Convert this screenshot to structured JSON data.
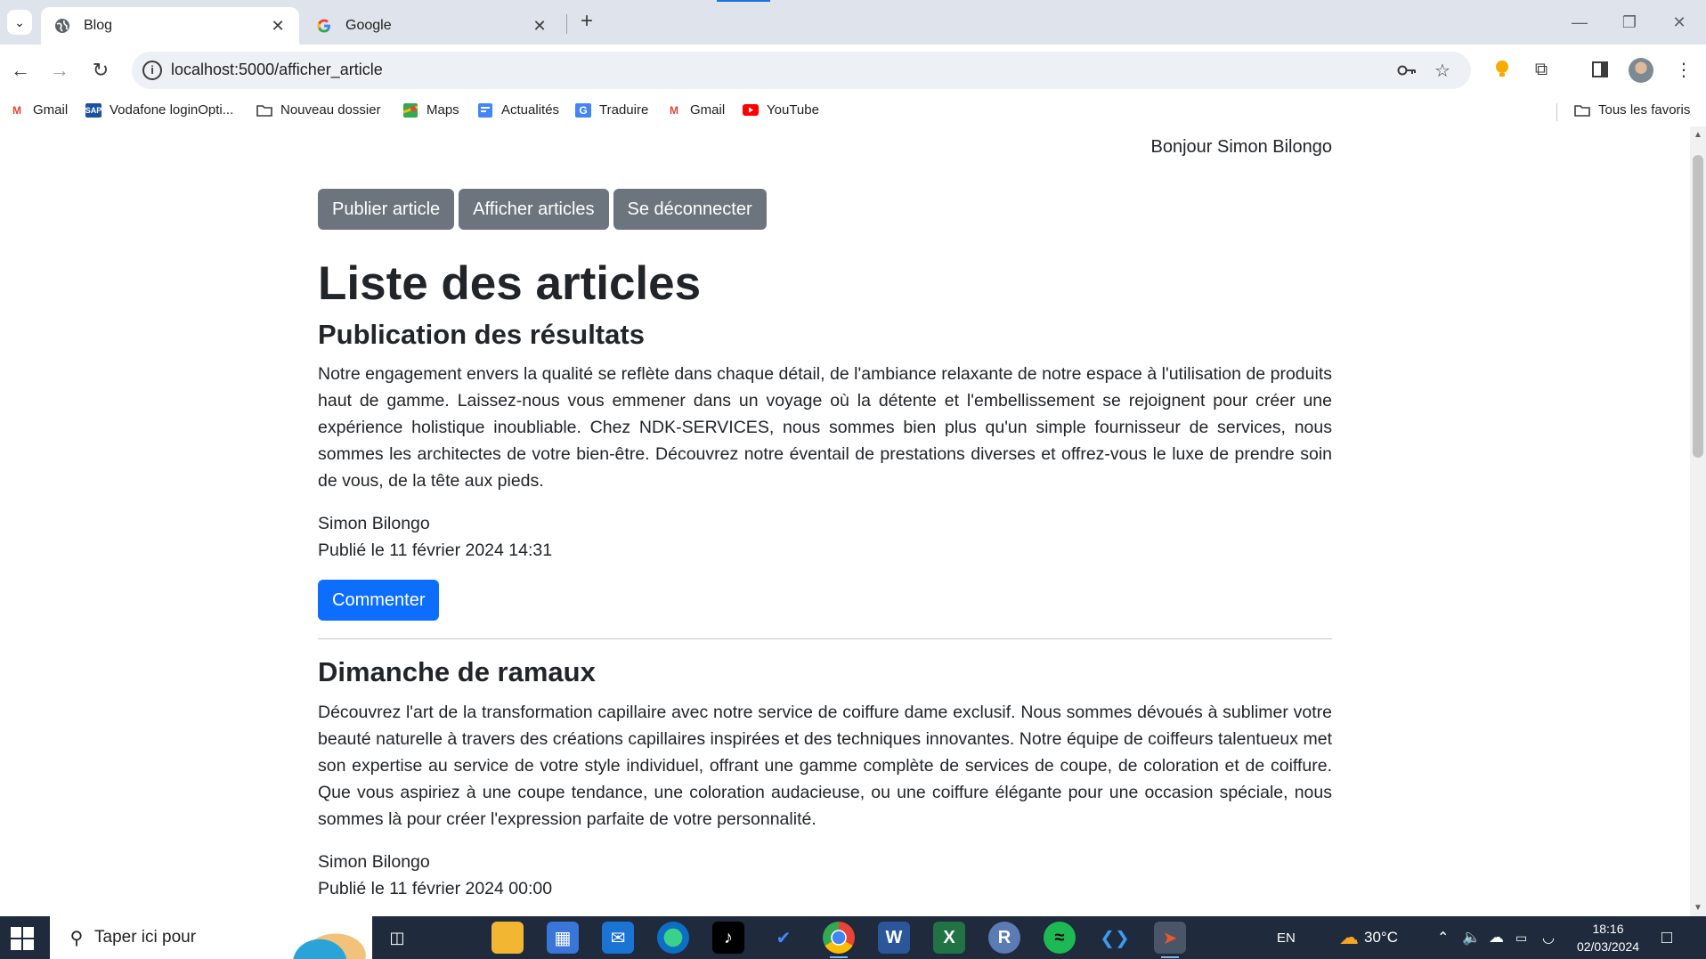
{
  "browser": {
    "tabs": [
      {
        "title": "Blog",
        "active": true
      },
      {
        "title": "Google",
        "active": false
      }
    ],
    "url": "localhost:5000/afficher_article",
    "bookmarks": [
      {
        "label": "Gmail",
        "icon": "gmail-icon"
      },
      {
        "label": "Vodafone loginOpti...",
        "icon": "vodafone-icon"
      },
      {
        "label": "Nouveau dossier",
        "icon": "folder-icon"
      },
      {
        "label": "Maps",
        "icon": "maps-icon"
      },
      {
        "label": "Actualités",
        "icon": "news-icon"
      },
      {
        "label": "Traduire",
        "icon": "translate-icon"
      },
      {
        "label": "Gmail",
        "icon": "gmail-icon"
      },
      {
        "label": "YouTube",
        "icon": "youtube-icon"
      }
    ],
    "all_bookmarks": "Tous les favoris"
  },
  "page": {
    "greeting": "Bonjour Simon Bilongo",
    "nav": {
      "publish": "Publier article",
      "list": "Afficher articles",
      "logout": "Se déconnecter"
    },
    "heading": "Liste des articles",
    "articles": [
      {
        "title": "Publication des résultats",
        "body": "Notre engagement envers la qualité se reflète dans chaque détail, de l'ambiance relaxante de notre espace à l'utilisation de produits haut de gamme. Laissez-nous vous emmener dans un voyage où la détente et l'embellissement se rejoignent pour créer une expérience holistique inoubliable. Chez NDK-SERVICES, nous sommes bien plus qu'un simple fournisseur de services, nous sommes les architectes de votre bien-être. Découvrez notre éventail de prestations diverses et offrez-vous le luxe de prendre soin de vous, de la tête aux pieds.",
        "author": "Simon Bilongo",
        "date": "Publié le 11 février 2024 14:31",
        "comment_label": "Commenter"
      },
      {
        "title": "Dimanche de ramaux",
        "body": "Découvrez l'art de la transformation capillaire avec notre service de coiffure dame exclusif. Nous sommes dévoués à sublimer votre beauté naturelle à travers des créations capillaires inspirées et des techniques innovantes. Notre équipe de coiffeurs talentueux met son expertise au service de votre style individuel, offrant une gamme complète de services de coupe, de coloration et de coiffure. Que vous aspiriez à une coupe tendance, une coloration audacieuse, ou une coiffure élégante pour une occasion spéciale, nous sommes là pour créer l'expression parfaite de votre personnalité.",
        "author": "Simon Bilongo",
        "date": "Publié le 11 février 2024 00:00"
      }
    ]
  },
  "taskbar": {
    "search_placeholder": "Taper ici pour",
    "language": "EN",
    "weather": "30°C",
    "time": "18:16",
    "date": "02/03/2024"
  },
  "colors": {
    "primary": "#0d6efd",
    "secondary": "#6c757d",
    "taskbar": "#1f2a3c"
  }
}
